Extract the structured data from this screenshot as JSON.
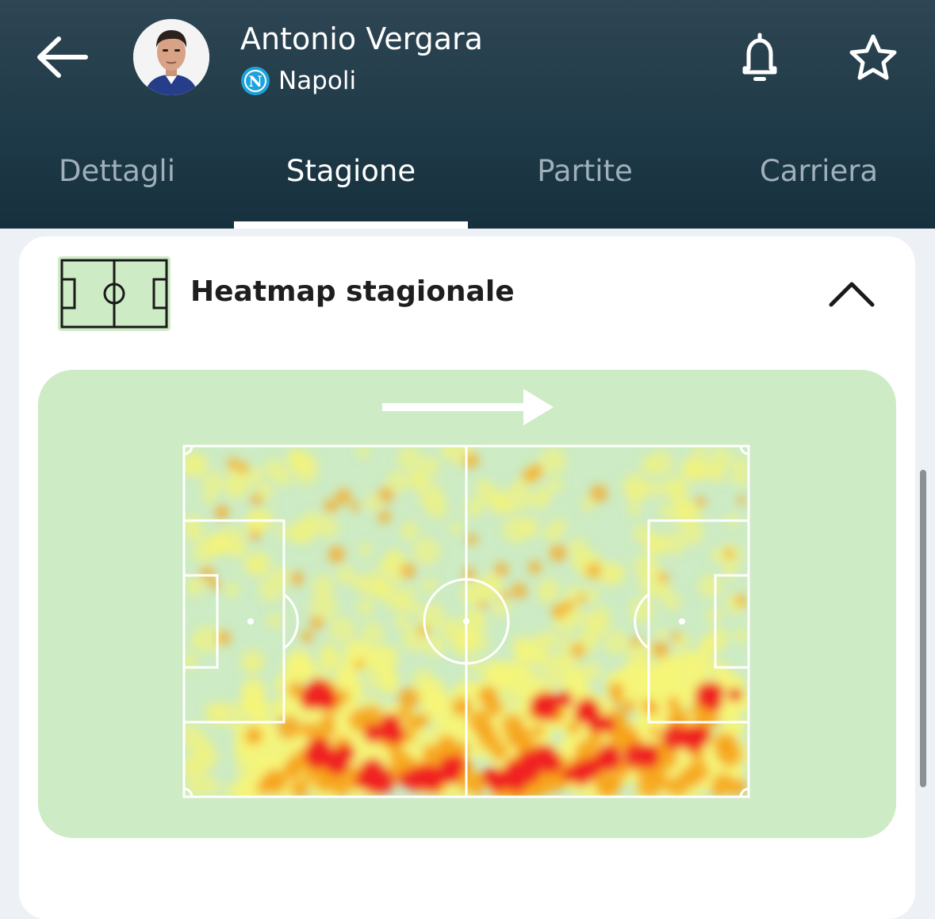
{
  "header": {
    "player_name": "Antonio Vergara",
    "team_name": "Napoli",
    "team_logo_letter": "N",
    "icons": {
      "back": "arrow-left-icon",
      "notifications": "bell-icon",
      "favorite": "star-outline-icon",
      "team_logo": "napoli-logo-icon"
    }
  },
  "tabs": [
    {
      "label": "Dettagli",
      "active": false
    },
    {
      "label": "Stagione",
      "active": true
    },
    {
      "label": "Partite",
      "active": false
    },
    {
      "label": "Carriera",
      "active": false
    }
  ],
  "heatmap_card": {
    "title": "Heatmap stagionale",
    "expanded": true,
    "icons": {
      "section": "football-pitch-icon",
      "collapse": "chevron-up-icon",
      "direction": "arrow-right-icon"
    },
    "attack_direction": "right"
  },
  "colors": {
    "header_bg": "#1f3a48",
    "card_bg": "#ffffff",
    "pitch_panel_bg": "#cdebc4",
    "heat_low": "#f4f478",
    "heat_mid": "#f7a51a",
    "heat_high": "#ef2121"
  }
}
